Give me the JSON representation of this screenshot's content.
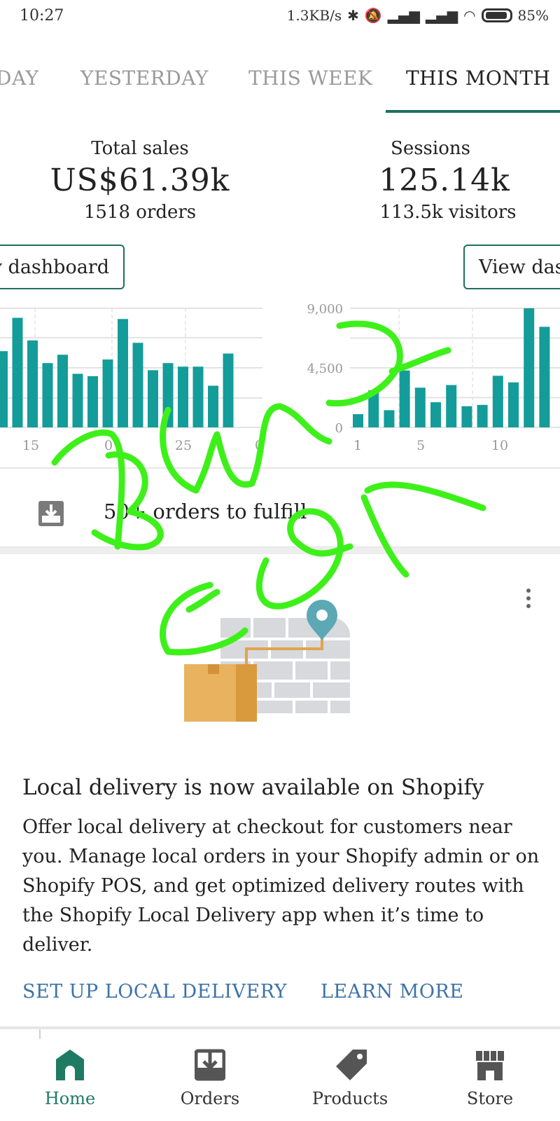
{
  "status_bar": {
    "time": "10:27",
    "net_speed": "1.3KB/s",
    "battery": "85%"
  },
  "tabs": [
    {
      "label": "DAY"
    },
    {
      "label": "YESTERDAY"
    },
    {
      "label": "THIS WEEK"
    },
    {
      "label": "THIS MONTH",
      "active": true
    }
  ],
  "metrics": {
    "sales": {
      "label": "Total sales",
      "value": "US$61.39k",
      "sub": "1518 orders",
      "button": "v dashboard"
    },
    "sessions": {
      "label": "Sessions",
      "value": "125.14k",
      "sub": "113.5k visitors",
      "button": "View das"
    }
  },
  "charts": {
    "sales": {
      "x_ticks": [
        "15",
        "0",
        "25",
        "0"
      ],
      "values": [
        64,
        92,
        73,
        54,
        61,
        45,
        43,
        57,
        91,
        71,
        48,
        54,
        51,
        51,
        35,
        62
      ]
    },
    "sessions": {
      "y_ticks": [
        "9,000",
        "4,500",
        "0"
      ],
      "x_ticks": [
        "1",
        "5",
        "10"
      ],
      "values": [
        1000,
        2800,
        1300,
        4300,
        3000,
        1900,
        3200,
        1600,
        1700,
        3900,
        3400,
        9000,
        7600
      ]
    }
  },
  "fulfill": {
    "text": "50+ orders to fulfill"
  },
  "card": {
    "title": "Local delivery is now available on Shopify",
    "body": "Offer local delivery at checkout for customers near you. Manage local orders in your Shopify admin or on Shopify POS, and get optimized delivery routes with the Shopify Local Delivery app when it’s time to deliver.",
    "primary_action": "SET UP LOCAL DELIVERY",
    "secondary_action": "LEARN MORE"
  },
  "bottom_nav": [
    {
      "label": "Home",
      "icon": "home-icon",
      "active": true
    },
    {
      "label": "Orders",
      "icon": "orders-inbox-icon"
    },
    {
      "label": "Products",
      "icon": "tag-icon"
    },
    {
      "label": "Store",
      "icon": "store-icon"
    }
  ],
  "colors": {
    "accent": "#1f6f5c",
    "bar": "#149c9a",
    "link": "#3d73a8",
    "scribble": "#3ef01a"
  }
}
